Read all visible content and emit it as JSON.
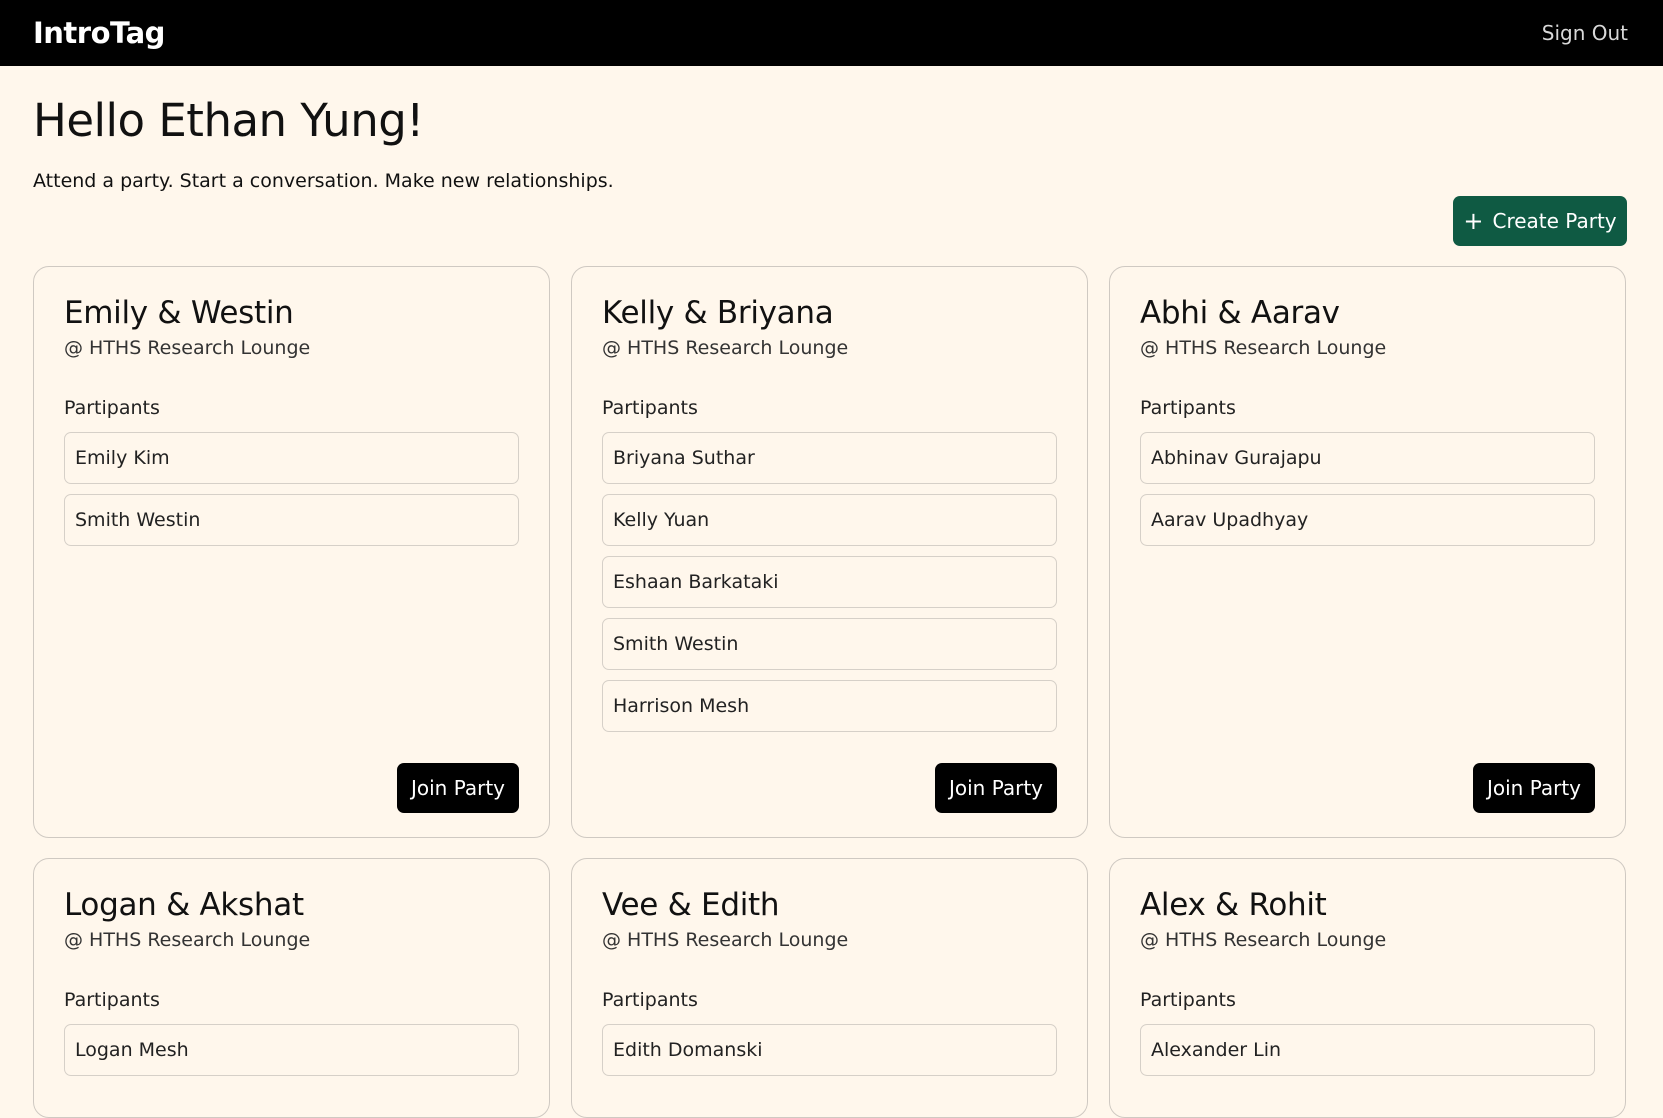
{
  "navbar": {
    "brand": "IntroTag",
    "sign_out": "Sign Out"
  },
  "header": {
    "greeting": "Hello Ethan Yung!",
    "tagline": "Attend a party. Start a conversation. Make new relationships.",
    "create_button": "Create Party",
    "create_icon": "plus-icon"
  },
  "parties": [
    {
      "title": "Emily & Westin",
      "location": "@ HTHS Research Lounge",
      "participants_label": "Partipants",
      "participants": [
        "Emily Kim",
        "Smith Westin"
      ],
      "join_label": "Join Party"
    },
    {
      "title": "Kelly & Briyana",
      "location": "@ HTHS Research Lounge",
      "participants_label": "Partipants",
      "participants": [
        "Briyana Suthar",
        "Kelly Yuan",
        "Eshaan Barkataki",
        "Smith Westin",
        "Harrison Mesh"
      ],
      "join_label": "Join Party"
    },
    {
      "title": "Abhi & Aarav",
      "location": "@ HTHS Research Lounge",
      "participants_label": "Partipants",
      "participants": [
        "Abhinav Gurajapu",
        "Aarav Upadhyay"
      ],
      "join_label": "Join Party"
    },
    {
      "title": "Logan & Akshat",
      "location": "@ HTHS Research Lounge",
      "participants_label": "Partipants",
      "participants": [
        "Logan Mesh"
      ],
      "join_label": ""
    },
    {
      "title": "Vee & Edith",
      "location": "@ HTHS Research Lounge",
      "participants_label": "Partipants",
      "participants": [
        "Edith Domanski"
      ],
      "join_label": ""
    },
    {
      "title": "Alex & Rohit",
      "location": "@ HTHS Research Lounge",
      "participants_label": "Partipants",
      "participants": [
        "Alexander Lin"
      ],
      "join_label": ""
    }
  ],
  "colors": {
    "background": "#fff7ec",
    "navbar": "#000000",
    "create_button": "#0f5a43",
    "join_button": "#000000"
  }
}
